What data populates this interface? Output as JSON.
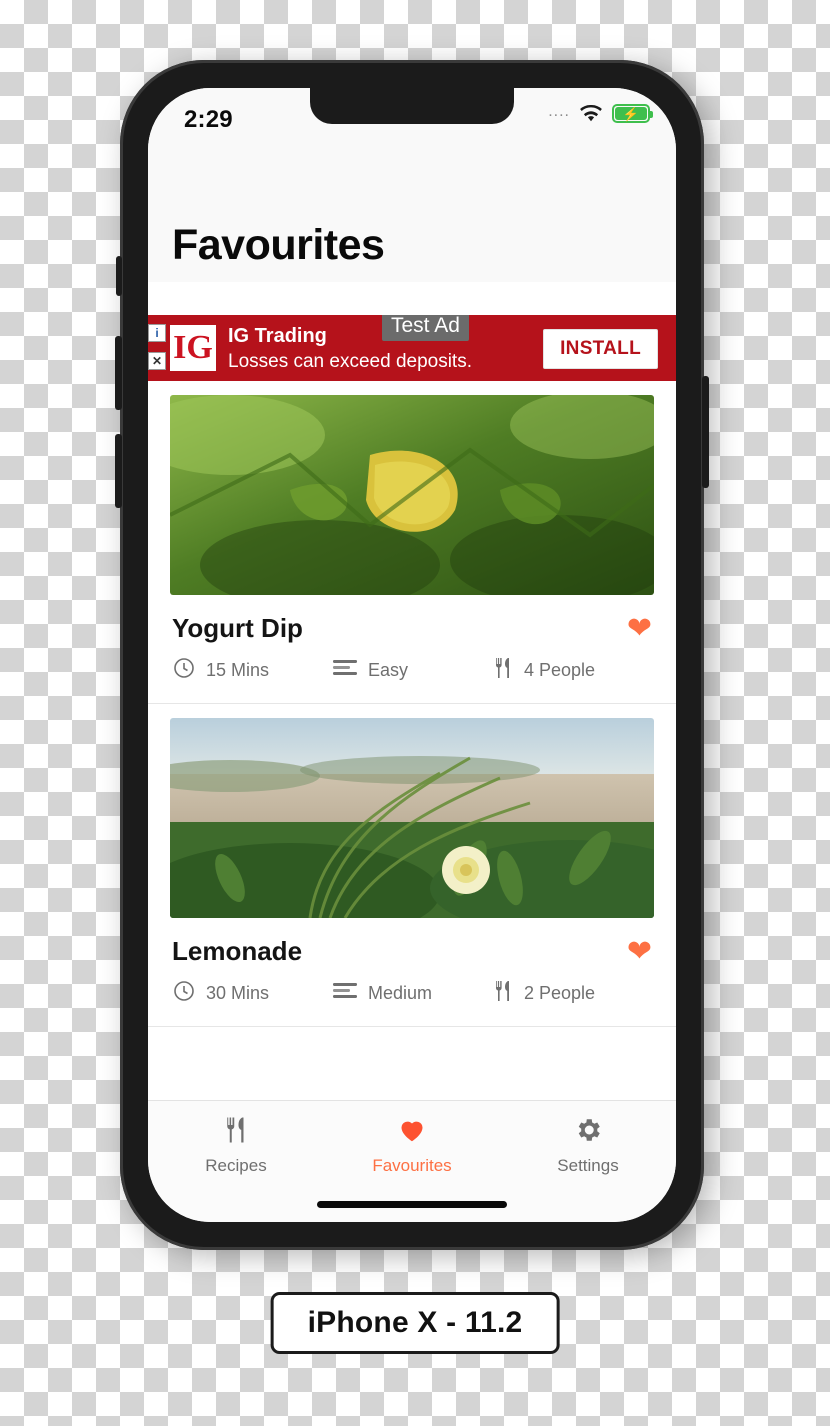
{
  "status_bar": {
    "time": "2:29",
    "signal_dots": "....",
    "wifi_icon": "wifi-icon",
    "battery_icon": "battery-charging-icon"
  },
  "header": {
    "title": "Favourites"
  },
  "ad": {
    "info_badge": "i",
    "close_badge": "✕",
    "logo_text": "IG",
    "advertiser": "IG Trading",
    "tagline": "Losses can exceed deposits.",
    "test_label": "Test Ad",
    "install_label": "INSTALL",
    "background_color": "#b5121b"
  },
  "recipes": [
    {
      "title": "Yogurt Dip",
      "favourite": true,
      "time": "15 Mins",
      "difficulty": "Easy",
      "servings": "4 People",
      "photo_alt": "green-leaves-photo"
    },
    {
      "title": "Lemonade",
      "favourite": true,
      "time": "30 Mins",
      "difficulty": "Medium",
      "servings": "2 People",
      "photo_alt": "beach-succulent-flower-photo"
    }
  ],
  "meta_icons": {
    "time": "clock-icon",
    "difficulty": "levels-icon",
    "servings": "cutlery-icon"
  },
  "tabs": [
    {
      "label": "Recipes",
      "icon": "cutlery-icon",
      "active": false
    },
    {
      "label": "Favourites",
      "icon": "heart-icon",
      "active": true
    },
    {
      "label": "Settings",
      "icon": "gear-icon",
      "active": false
    }
  ],
  "device_label": "iPhone X - 11.2",
  "colors": {
    "accent": "#fd7043",
    "accent_strong": "#fd5230",
    "ad_red": "#b5121b",
    "battery_green": "#3fbf4d",
    "muted_text": "#6f6f6f"
  }
}
